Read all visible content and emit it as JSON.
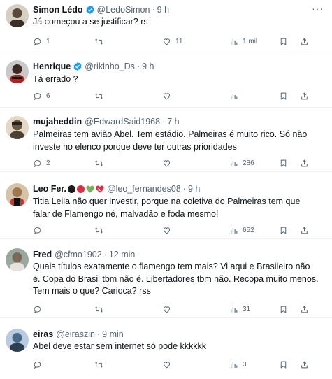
{
  "tweets": [
    {
      "name": "Simon Lédo",
      "verified": true,
      "handle": "@LedoSimon",
      "sep": "·",
      "time": "9 h",
      "text": "Já começou a se justificar? rs",
      "replies": "1",
      "retweets": "",
      "likes": "11",
      "views": "1 mil",
      "avatar_color": "#5a4a3c"
    },
    {
      "name": "Henrique",
      "verified": true,
      "handle": "@rikinho_Ds",
      "sep": "·",
      "time": "9 h",
      "text": "Tá errado ?",
      "replies": "6",
      "retweets": "",
      "likes": "",
      "views": "",
      "avatar_color": "#2b2b2b"
    },
    {
      "name": "mujaheddin",
      "verified": false,
      "handle": "@EdwardSaid1968",
      "sep": "·",
      "time": "7 h",
      "text": "Palmeiras tem avião Abel. Tem estádio. Palmeiras é muito rico. Só não investe no elenco porque deve ter outras prioridades",
      "replies": "2",
      "retweets": "",
      "likes": "",
      "views": "286",
      "avatar_color": "#6b5a40"
    },
    {
      "name": "Leo Fer.",
      "verified": false,
      "emojis": [
        "black-circle",
        "red-circle",
        "green-heart",
        "mended-heart"
      ],
      "handle": "@leo_fernandes08",
      "sep": "·",
      "time": "9 h",
      "text": "Titia Leila não quer investir, porque na coletiva do Palmeiras tem que falar de Flamengo né, malvadão e foda mesmo!",
      "replies": "",
      "retweets": "",
      "likes": "",
      "views": "652",
      "avatar_color": "#a07850"
    },
    {
      "name": "Fred",
      "verified": false,
      "handle": "@cfmo1902",
      "sep": "·",
      "time": "12 min",
      "text": "Quais títulos exatamente o flamengo tem mais? Vi aqui e Brasileiro não é. Copa do Brasil tbm não é. Libertadores tbm não. Recopa muito menos. Tem mais o que? Carioca? rss",
      "replies": "",
      "retweets": "",
      "likes": "",
      "views": "31",
      "avatar_color": "#7a6a55"
    },
    {
      "name": "eiras",
      "verified": false,
      "handle": "@eiraszin",
      "sep": "·",
      "time": "9 min",
      "text": "Abel deve estar sem internet só pode kkkkkk",
      "replies": "",
      "retweets": "",
      "likes": "",
      "views": "3",
      "avatar_color": "#4a6a8a"
    }
  ],
  "more_label": "···",
  "colors": {
    "verified": "#1d9bf0",
    "secondary": "#536471",
    "divider": "#eff3f4"
  }
}
